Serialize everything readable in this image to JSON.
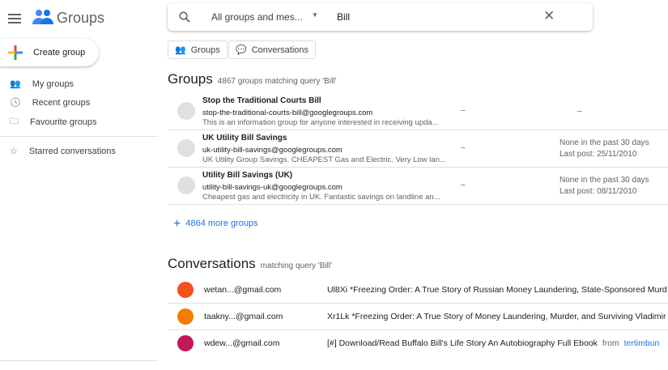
{
  "app": {
    "title": "Groups"
  },
  "sidebar": {
    "create_label": "Create group",
    "items": [
      {
        "label": "My groups"
      },
      {
        "label": "Recent groups"
      },
      {
        "label": "Favourite groups"
      },
      {
        "label": "Starred conversations"
      }
    ]
  },
  "search": {
    "scope": "All groups and mes...",
    "query": "Bill"
  },
  "filters": {
    "groups": "Groups",
    "conversations": "Conversations"
  },
  "groups": {
    "title": "Groups",
    "count": "4867 groups matching query 'Bill'",
    "more": "4864 more groups",
    "rows": [
      {
        "name": "Stop the Traditional Courts Bill",
        "email": "stop-the-traditional-courts-bill@googlegroups.com",
        "desc": "This is an information group for anyone interested in receiving upda...",
        "members": "–",
        "activity1": "–",
        "activity2": ""
      },
      {
        "name": "UK Utility Bill Savings",
        "email": "uk-utility-bill-savings@googlegroups.com",
        "desc": "UK Utility Group Savings. CHEAPEST Gas and Electric. Very Low lan...",
        "members": "–",
        "activity1": "None in the past 30 days",
        "activity2": "Last post: 25/11/2010"
      },
      {
        "name": "Utility Bill Savings (UK)",
        "email": "utility-bill-savings-uk@googlegroups.com",
        "desc": "Cheapest gas and electricity in UK. Fantastic savings on landline an...",
        "members": "–",
        "activity1": "None in the past 30 days",
        "activity2": "Last post: 08/11/2010"
      }
    ]
  },
  "conversations": {
    "title": "Conversations",
    "sub": "matching query 'Bill'",
    "rows": [
      {
        "from": "wetan...@gmail.com",
        "subject": "Ul8Xi *Freezing Order: A True Story of Russian Money Laundering, State-Sponsored Murd",
        "group_from": "",
        "group": "",
        "color": "#f4511e"
      },
      {
        "from": "taakny...@gmail.com",
        "subject": "Xr1Lk *Freezing Order: A True Story of Money Laundering, Murder, and Surviving Vladimir",
        "group_from": "",
        "group": "",
        "color": "#f57c00"
      },
      {
        "from": "wdew...@gmail.com",
        "subject": "[#] Download/Read Buffalo Bill's Life Story An Autobiography Full Ebook",
        "group_from": "from",
        "group": "tertimbun",
        "color": "#c2185b"
      }
    ]
  }
}
